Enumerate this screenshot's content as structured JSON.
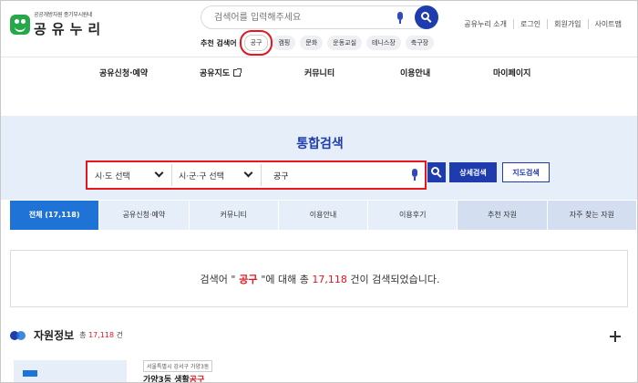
{
  "header": {
    "logo_sub": "공공개방자원 종기부시원네",
    "logo_main": "공유누리",
    "search_placeholder": "검색어를 입력해주세요",
    "recommend_label": "추천 검색어",
    "recommend_tags": [
      "공구",
      "캠핑",
      "문화",
      "운동교실",
      "테니스장",
      "축구장"
    ],
    "util_links": [
      "공유누리 소개",
      "로그인",
      "회원가입",
      "사이트맵"
    ]
  },
  "gnb": {
    "items": [
      "공유신청·예약",
      "공유지도",
      "커뮤니티",
      "이용안내",
      "마이페이지"
    ]
  },
  "search_panel": {
    "title": "통합검색",
    "sido_select": "시·도 선택",
    "sigungu_select": "시·군·구 선택",
    "query": "공구",
    "detail_button": "상세검색",
    "map_button": "지도검색"
  },
  "tabs": [
    {
      "label": "전체 (17,118)"
    },
    {
      "label": "공유신청·예약"
    },
    {
      "label": "커뮤니티"
    },
    {
      "label": "이용안내"
    },
    {
      "label": "이용후기"
    },
    {
      "label": "추천 자원"
    },
    {
      "label": "자주 찾는 자원"
    }
  ],
  "result": {
    "prefix": "검색어 \"",
    "keyword": " 공구 ",
    "middle": "\"에 대해 총 ",
    "count": "17,118",
    "suffix": " 건이 검색되었습니다."
  },
  "resource": {
    "title": "자원정보",
    "count_prefix": "총 ",
    "count": "17,118",
    "count_suffix": " 건",
    "card_region": "서울특별시 강서구 가양3동",
    "card_name_prefix": "가양3동 생활",
    "card_name_keyword": "공구"
  },
  "colors": {
    "primary": "#1f3cae",
    "tab_active": "#1f73d6",
    "panel_bg": "#e6eef9",
    "highlight": "#e4161e",
    "logo_green": "#26a84a"
  }
}
